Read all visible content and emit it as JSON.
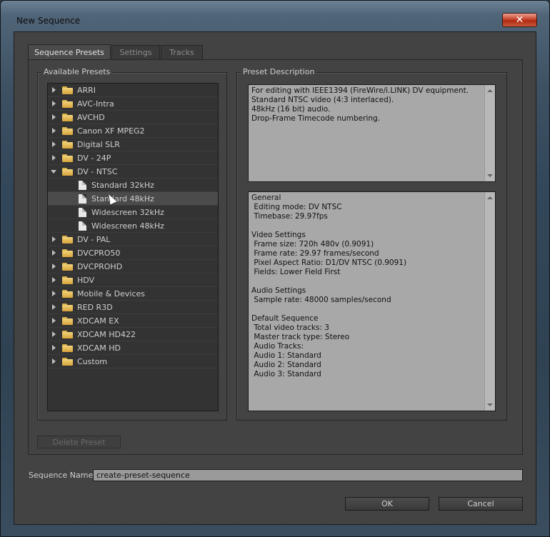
{
  "window": {
    "title": "New Sequence",
    "close_label": "✕"
  },
  "tabs": [
    {
      "label": "Sequence Presets"
    },
    {
      "label": "Settings"
    },
    {
      "label": "Tracks"
    }
  ],
  "presets": {
    "group_label": "Available Presets",
    "items": [
      {
        "label": "ARRI"
      },
      {
        "label": "AVC-Intra"
      },
      {
        "label": "AVCHD"
      },
      {
        "label": "Canon XF MPEG2"
      },
      {
        "label": "Digital SLR"
      },
      {
        "label": "DV - 24P"
      },
      {
        "label": "DV - NTSC",
        "expanded": true
      },
      {
        "label": "Standard 32kHz"
      },
      {
        "label": "Standard 48kHz",
        "selected": true
      },
      {
        "label": "Widescreen 32kHz"
      },
      {
        "label": "Widescreen 48kHz"
      },
      {
        "label": "DV - PAL"
      },
      {
        "label": "DVCPRO50"
      },
      {
        "label": "DVCPROHD"
      },
      {
        "label": "HDV"
      },
      {
        "label": "Mobile & Devices"
      },
      {
        "label": "RED R3D"
      },
      {
        "label": "XDCAM EX"
      },
      {
        "label": "XDCAM HD422"
      },
      {
        "label": "XDCAM HD"
      },
      {
        "label": "Custom"
      }
    ],
    "delete_button": "Delete Preset"
  },
  "description": {
    "group_label": "Preset Description",
    "summary_lines": [
      "For editing with IEEE1394 (FireWire/i.LINK) DV equipment.",
      "Standard NTSC video (4:3 interlaced).",
      "48kHz (16 bit) audio.",
      "Drop-Frame Timecode numbering."
    ],
    "detail_lines": [
      "General",
      " Editing mode: DV NTSC",
      " Timebase: 29.97fps",
      "",
      "Video Settings",
      " Frame size: 720h 480v (0.9091)",
      " Frame rate: 29.97 frames/second",
      " Pixel Aspect Ratio: D1/DV NTSC (0.9091)",
      " Fields: Lower Field First",
      "",
      "Audio Settings",
      " Sample rate: 48000 samples/second",
      "",
      "Default Sequence",
      " Total video tracks: 3",
      " Master track type: Stereo",
      " Audio Tracks:",
      " Audio 1: Standard",
      " Audio 2: Standard",
      " Audio 3: Standard"
    ]
  },
  "sequence_name": {
    "label": "Sequence Name:",
    "value": "create-preset-sequence"
  },
  "buttons": {
    "ok": "OK",
    "cancel": "Cancel"
  }
}
